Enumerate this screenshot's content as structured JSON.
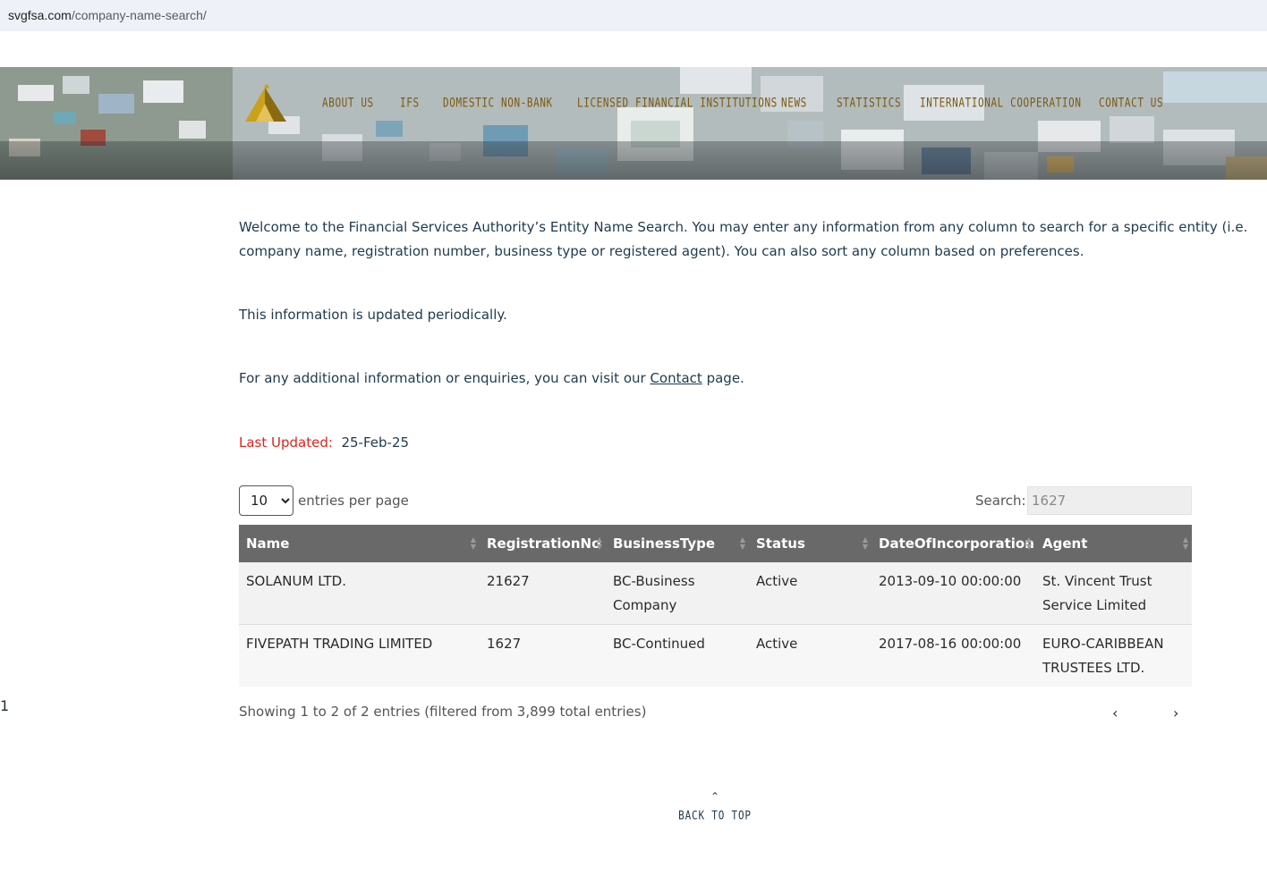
{
  "browser": {
    "url_host": "svgfsa.com",
    "url_path": "/company-name-search/"
  },
  "nav": {
    "items": [
      "ABOUT US",
      "IFS",
      "DOMESTIC NON-BANK",
      "LICENSED FINANCIAL INSTITUTIONS",
      "NEWS",
      "STATISTICS",
      "INTERNATIONAL COOPERATION",
      "CONTACT US"
    ],
    "color": "#7c5a10"
  },
  "intro": {
    "line1": "Welcome to the Financial Services Authority’s Entity Name Search. You may enter any information from any column to search for a specific entity (i.e.",
    "line2": "company name, registration number, business type or registered agent). You can also sort any column based on preferences.",
    "updated_note": "This information is updated periodically.",
    "enquiry_prefix": "For any additional information or enquiries, you can visit our ",
    "enquiry_link": "Contact",
    "enquiry_suffix": " page.",
    "last_updated_label": "Last Updated:",
    "last_updated_value": "25-Feb-25"
  },
  "controls": {
    "page_length": "10",
    "page_length_options": [
      "10"
    ],
    "entries_label": "entries per page",
    "search_label": "Search:",
    "search_value": "1627"
  },
  "table": {
    "columns": [
      "Name",
      "RegistrationNo",
      "BusinessType",
      "Status",
      "DateOfIncorporation",
      "Agent"
    ],
    "rows": [
      {
        "name": "SOLANUM LTD.",
        "reg": "21627",
        "type_l1": "BC-Business",
        "type_l2": "Company",
        "status": "Active",
        "date": "2013-09-10 00:00:00",
        "agent_l1": "St. Vincent Trust",
        "agent_l2": "Service Limited"
      },
      {
        "name": "FIVEPATH TRADING LIMITED",
        "reg": "1627",
        "type_l1": "BC-Continued",
        "type_l2": "",
        "status": "Active",
        "date": "2017-08-16 00:00:00",
        "agent_l1": "EURO-CARIBBEAN",
        "agent_l2": "TRUSTEES LTD."
      }
    ]
  },
  "footer": {
    "info": "Showing 1 to 2 of 2 entries (filtered from 3,899 total entries)",
    "prev": "‹",
    "page": "1",
    "next": "›",
    "back_to_top_icon": "chevron-up-icon",
    "back_to_top": "BACK TO TOP"
  },
  "colors": {
    "accent_red": "#e0231b",
    "text_navy": "#1e3a4e",
    "header_gray": "#696969"
  }
}
